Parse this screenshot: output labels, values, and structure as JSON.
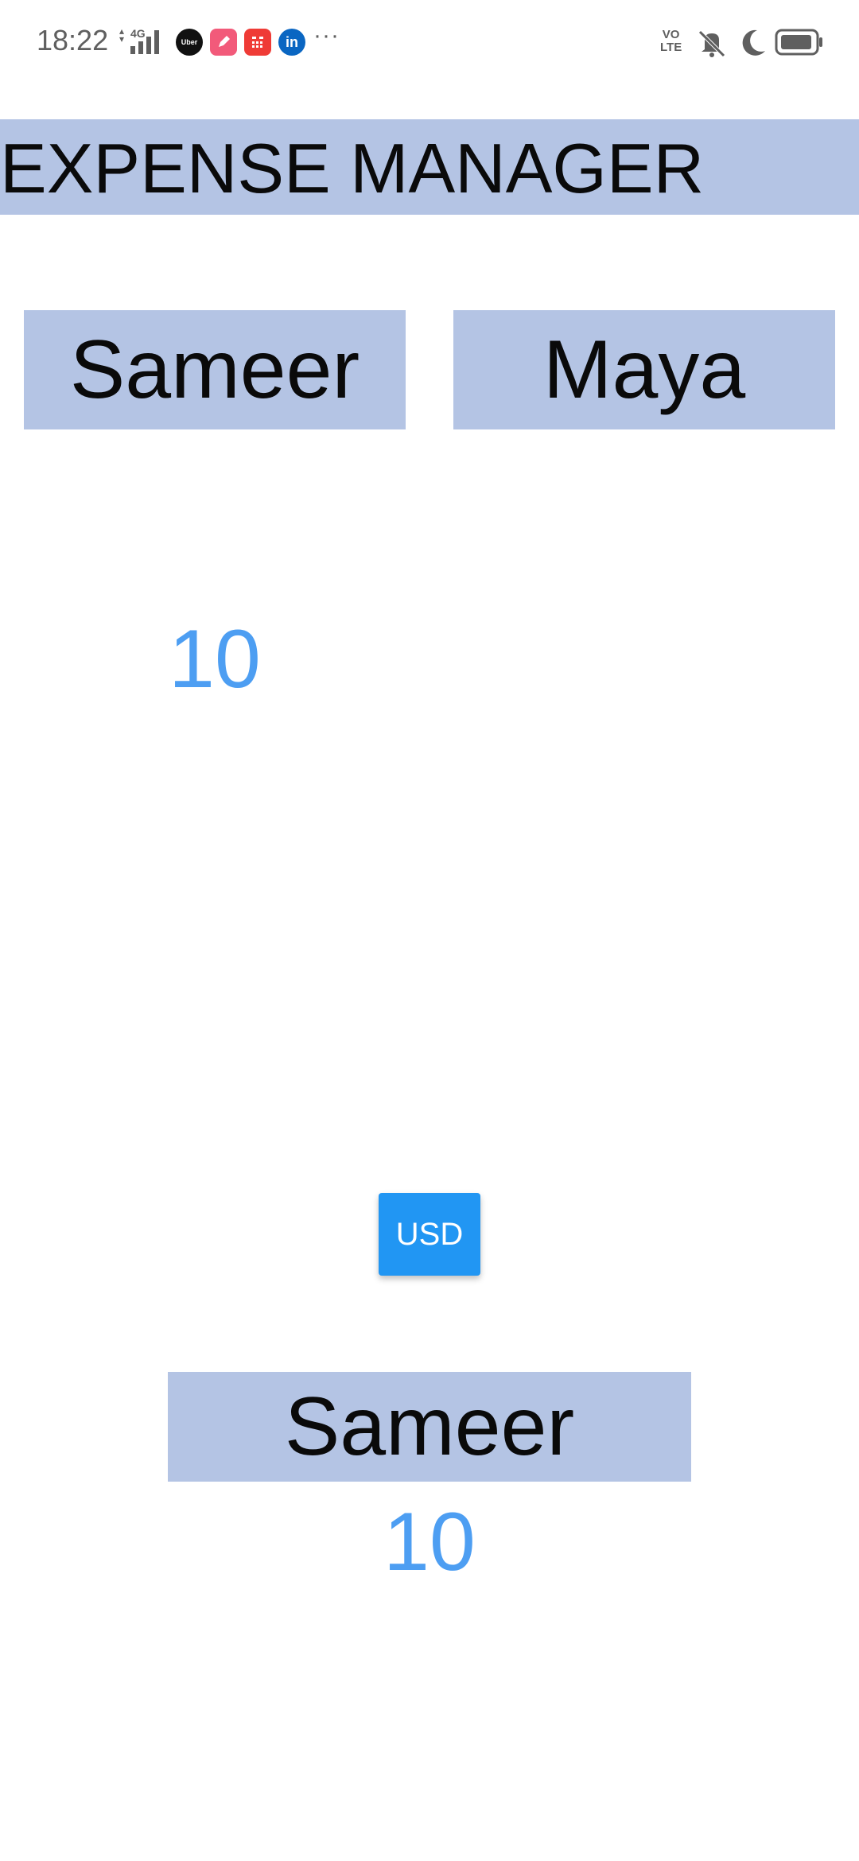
{
  "status_bar": {
    "time": "18:22",
    "network_label": "4G",
    "notification_icons": [
      "uber-icon",
      "pen-app-icon",
      "calculator-app-icon",
      "linkedin-icon"
    ],
    "uber_label": "Uber",
    "linkedin_label": "in",
    "more": "···",
    "volte_top": "VO",
    "volte_bottom": "LTE",
    "system_icons": [
      "mute-icon",
      "do-not-disturb-moon-icon",
      "battery-icon"
    ]
  },
  "header": {
    "title": "EXPENSE MANAGER"
  },
  "people": {
    "left": {
      "name": "Sameer",
      "amount": "10"
    },
    "right": {
      "name": "Maya"
    }
  },
  "currency": {
    "label": "USD"
  },
  "result": {
    "name": "Sameer",
    "amount": "10"
  },
  "colors": {
    "panel_bg": "#b4c4e4",
    "accent_blue": "#2196f3",
    "amount_blue": "#4d9ef2"
  }
}
